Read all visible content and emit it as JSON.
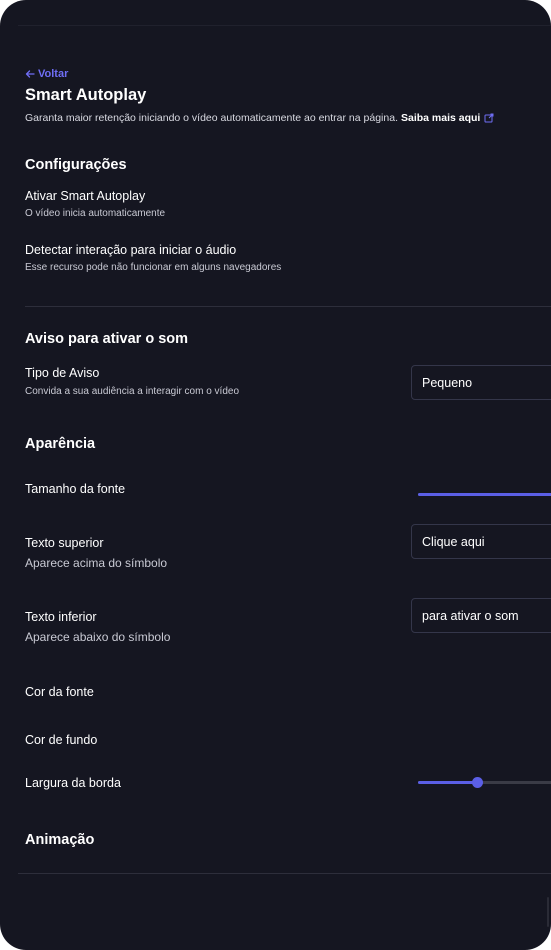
{
  "header": {
    "back_label": "Voltar",
    "title": "Smart Autoplay",
    "description": "Garanta maior retenção iniciando o vídeo automaticamente ao entrar na página.",
    "learn_more": "Saiba mais aqui"
  },
  "settings": {
    "heading": "Configurações",
    "smart_autoplay": {
      "label": "Ativar Smart Autoplay",
      "sub": "O vídeo inicia automaticamente"
    },
    "detect_interaction": {
      "label": "Detectar interação para iniciar o áudio",
      "sub": "Esse recurso pode não funcionar em alguns navegadores"
    }
  },
  "sound_notice": {
    "heading": "Aviso para ativar o som",
    "type": {
      "label": "Tipo de Aviso",
      "sub": "Convida a sua audiência a interagir com o vídeo",
      "value": "Pequeno"
    }
  },
  "appearance": {
    "heading": "Aparência",
    "font_size": {
      "label": "Tamanho da fonte",
      "fill_fraction": 1.0
    },
    "top_text": {
      "label": "Texto superior",
      "sub": "Aparece acima do símbolo",
      "value": "Clique aqui"
    },
    "bottom_text": {
      "label": "Texto inferior",
      "sub": "Aparece abaixo do símbolo",
      "value": "para ativar o som"
    },
    "font_color": {
      "label": "Cor da fonte"
    },
    "background_color": {
      "label": "Cor de fundo"
    },
    "border_width": {
      "label": "Largura da borda",
      "fill_fraction": 0.42
    }
  },
  "animation": {
    "heading": "Animação"
  },
  "colors": {
    "accent": "#5b5fe6",
    "link": "#6f6ef5",
    "background": "#151621"
  }
}
